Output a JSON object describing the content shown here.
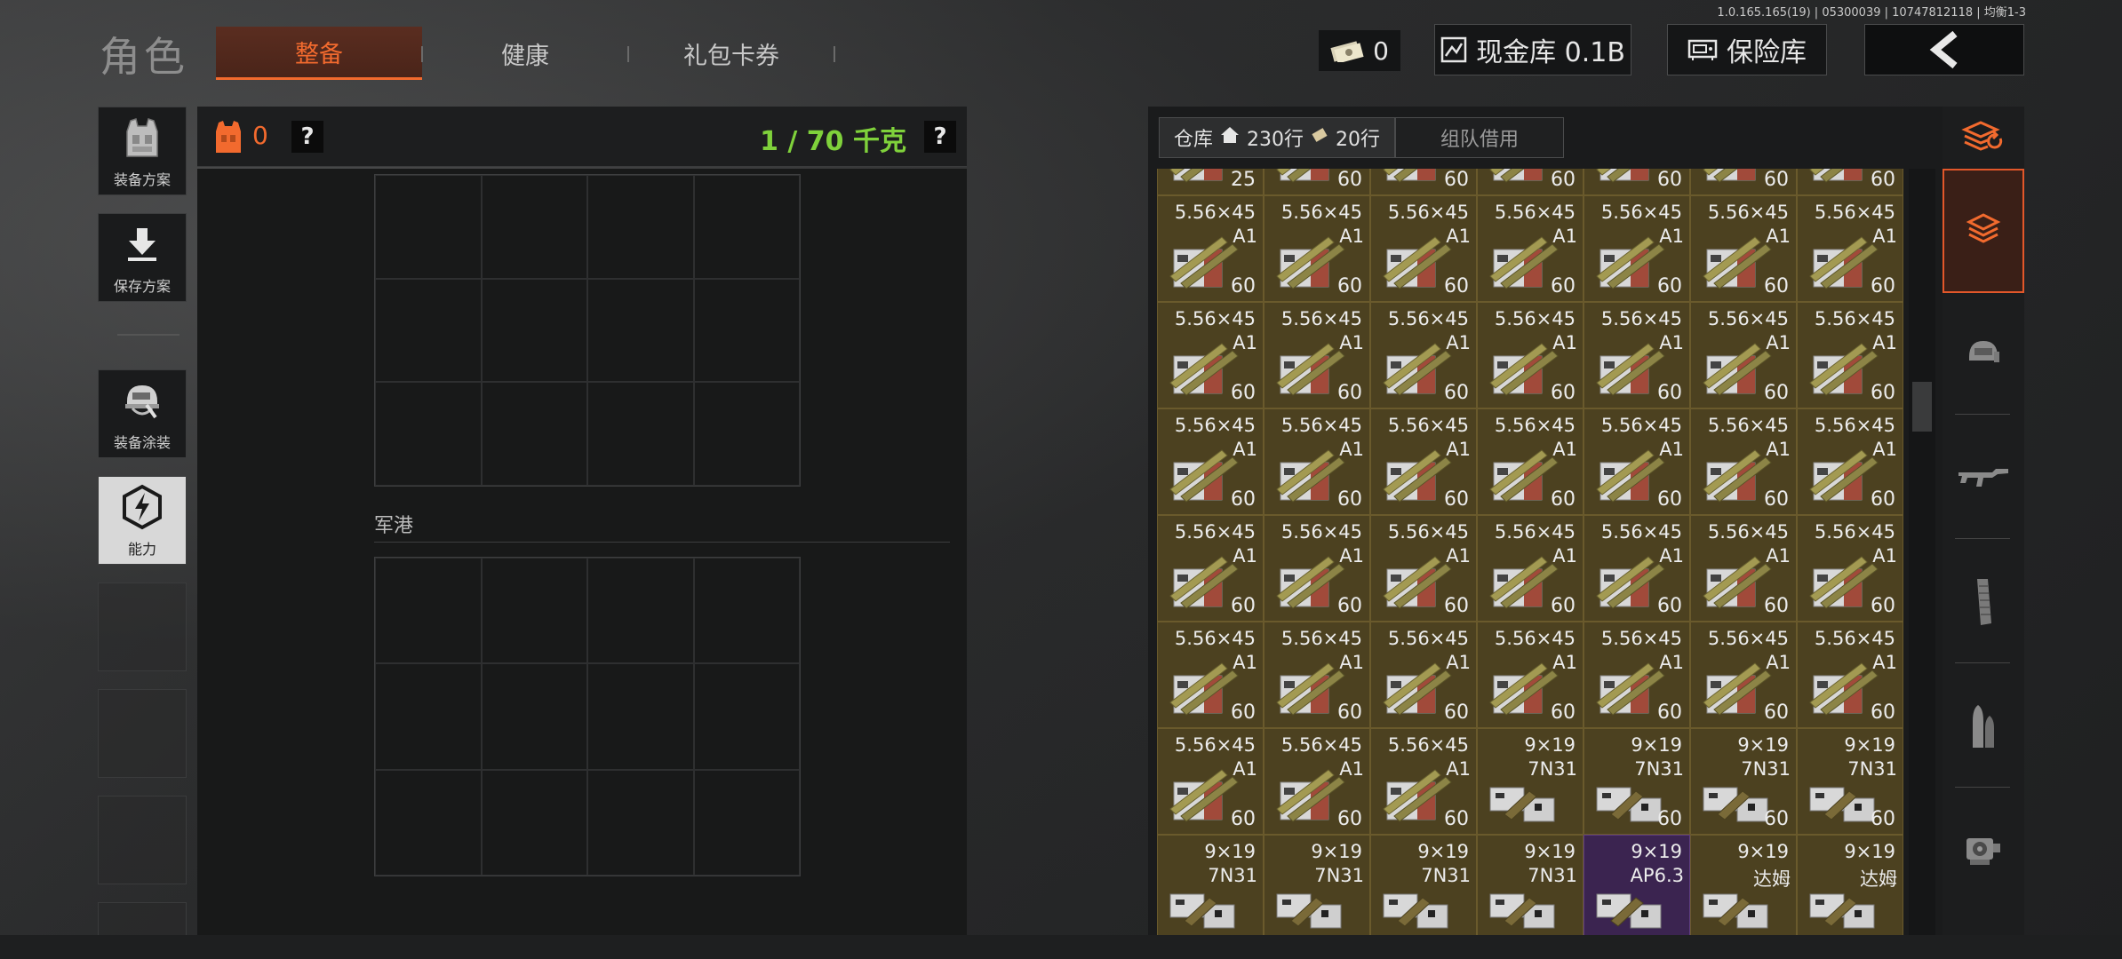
{
  "version": "1.0.165.165(19) | 05300039 | 10747812118 | 均衡1-3",
  "header": {
    "title": "角色",
    "tabs": [
      {
        "label": "整备",
        "active": true
      },
      {
        "label": "健康",
        "active": false
      },
      {
        "label": "礼包卡券",
        "active": false
      }
    ],
    "cash": "0",
    "vault_label": "现金库 0.1B",
    "safe_label": "保险库",
    "back_icon": "chevron-left-icon"
  },
  "sidebar": {
    "items": [
      {
        "label": "装备方案",
        "icon": "vest-icon"
      },
      {
        "label": "保存方案",
        "icon": "download-icon"
      },
      {
        "label": "装备涂装",
        "icon": "helmet-icon"
      },
      {
        "label": "能力",
        "icon": "hex-lightning-icon"
      }
    ]
  },
  "backpack": {
    "armor_count": "0",
    "weight": "1 / 70 千克",
    "help": "?",
    "section_label": "军港"
  },
  "storage": {
    "tab_label": "仓库",
    "rows_home": "230行",
    "rows_ticket": "20行",
    "team_tab": "组队借用",
    "grid": {
      "top_partial_counts": [
        "25",
        "60",
        "60",
        "60",
        "60",
        "60",
        "60"
      ],
      "rows": [
        [
          {
            "t1": "5.56×45",
            "t2": "A1",
            "count": "60",
            "type": "rifle"
          },
          {
            "t1": "5.56×45",
            "t2": "A1",
            "count": "60",
            "type": "rifle"
          },
          {
            "t1": "5.56×45",
            "t2": "A1",
            "count": "60",
            "type": "rifle"
          },
          {
            "t1": "5.56×45",
            "t2": "A1",
            "count": "60",
            "type": "rifle"
          },
          {
            "t1": "5.56×45",
            "t2": "A1",
            "count": "60",
            "type": "rifle"
          },
          {
            "t1": "5.56×45",
            "t2": "A1",
            "count": "60",
            "type": "rifle"
          },
          {
            "t1": "5.56×45",
            "t2": "A1",
            "count": "60",
            "type": "rifle"
          }
        ],
        [
          {
            "t1": "5.56×45",
            "t2": "A1",
            "count": "60",
            "type": "rifle"
          },
          {
            "t1": "5.56×45",
            "t2": "A1",
            "count": "60",
            "type": "rifle"
          },
          {
            "t1": "5.56×45",
            "t2": "A1",
            "count": "60",
            "type": "rifle"
          },
          {
            "t1": "5.56×45",
            "t2": "A1",
            "count": "60",
            "type": "rifle"
          },
          {
            "t1": "5.56×45",
            "t2": "A1",
            "count": "60",
            "type": "rifle"
          },
          {
            "t1": "5.56×45",
            "t2": "A1",
            "count": "60",
            "type": "rifle"
          },
          {
            "t1": "5.56×45",
            "t2": "A1",
            "count": "60",
            "type": "rifle"
          }
        ],
        [
          {
            "t1": "5.56×45",
            "t2": "A1",
            "count": "60",
            "type": "rifle"
          },
          {
            "t1": "5.56×45",
            "t2": "A1",
            "count": "60",
            "type": "rifle"
          },
          {
            "t1": "5.56×45",
            "t2": "A1",
            "count": "60",
            "type": "rifle"
          },
          {
            "t1": "5.56×45",
            "t2": "A1",
            "count": "60",
            "type": "rifle"
          },
          {
            "t1": "5.56×45",
            "t2": "A1",
            "count": "60",
            "type": "rifle"
          },
          {
            "t1": "5.56×45",
            "t2": "A1",
            "count": "60",
            "type": "rifle"
          },
          {
            "t1": "5.56×45",
            "t2": "A1",
            "count": "60",
            "type": "rifle"
          }
        ],
        [
          {
            "t1": "5.56×45",
            "t2": "A1",
            "count": "60",
            "type": "rifle"
          },
          {
            "t1": "5.56×45",
            "t2": "A1",
            "count": "60",
            "type": "rifle"
          },
          {
            "t1": "5.56×45",
            "t2": "A1",
            "count": "60",
            "type": "rifle"
          },
          {
            "t1": "5.56×45",
            "t2": "A1",
            "count": "60",
            "type": "rifle"
          },
          {
            "t1": "5.56×45",
            "t2": "A1",
            "count": "60",
            "type": "rifle"
          },
          {
            "t1": "5.56×45",
            "t2": "A1",
            "count": "60",
            "type": "rifle"
          },
          {
            "t1": "5.56×45",
            "t2": "A1",
            "count": "60",
            "type": "rifle"
          }
        ],
        [
          {
            "t1": "5.56×45",
            "t2": "A1",
            "count": "60",
            "type": "rifle"
          },
          {
            "t1": "5.56×45",
            "t2": "A1",
            "count": "60",
            "type": "rifle"
          },
          {
            "t1": "5.56×45",
            "t2": "A1",
            "count": "60",
            "type": "rifle"
          },
          {
            "t1": "5.56×45",
            "t2": "A1",
            "count": "60",
            "type": "rifle"
          },
          {
            "t1": "5.56×45",
            "t2": "A1",
            "count": "60",
            "type": "rifle"
          },
          {
            "t1": "5.56×45",
            "t2": "A1",
            "count": "60",
            "type": "rifle"
          },
          {
            "t1": "5.56×45",
            "t2": "A1",
            "count": "60",
            "type": "rifle"
          }
        ],
        [
          {
            "t1": "5.56×45",
            "t2": "A1",
            "count": "60",
            "type": "rifle"
          },
          {
            "t1": "5.56×45",
            "t2": "A1",
            "count": "60",
            "type": "rifle"
          },
          {
            "t1": "5.56×45",
            "t2": "A1",
            "count": "60",
            "type": "rifle"
          },
          {
            "t1": "9×19",
            "t2": "7N31",
            "count": "",
            "type": "pistol"
          },
          {
            "t1": "9×19",
            "t2": "7N31",
            "count": "60",
            "type": "pistol"
          },
          {
            "t1": "9×19",
            "t2": "7N31",
            "count": "60",
            "type": "pistol"
          },
          {
            "t1": "9×19",
            "t2": "7N31",
            "count": "60",
            "type": "pistol"
          }
        ],
        [
          {
            "t1": "9×19",
            "t2": "7N31",
            "count": "",
            "type": "pistol"
          },
          {
            "t1": "9×19",
            "t2": "7N31",
            "count": "",
            "type": "pistol"
          },
          {
            "t1": "9×19",
            "t2": "7N31",
            "count": "",
            "type": "pistol"
          },
          {
            "t1": "9×19",
            "t2": "7N31",
            "count": "",
            "type": "pistol"
          },
          {
            "t1": "9×19",
            "t2": "AP6.3",
            "count": "",
            "type": "pistol",
            "rarity": "purple"
          },
          {
            "t1": "9×19",
            "t2": "达姆",
            "count": "",
            "type": "pistol"
          },
          {
            "t1": "9×19",
            "t2": "达姆",
            "count": "",
            "type": "pistol"
          }
        ]
      ]
    }
  },
  "categories": [
    {
      "icon": "stack-refresh-icon",
      "active": false
    },
    {
      "icon": "stack-icon",
      "active": true
    },
    {
      "icon": "helmet-icon",
      "active": false
    },
    {
      "icon": "rifle-icon",
      "active": false
    },
    {
      "icon": "magazine-icon",
      "active": false
    },
    {
      "icon": "ammo-icon",
      "active": false
    },
    {
      "icon": "scope-icon",
      "active": false
    }
  ],
  "colors": {
    "accent": "#f26a2e",
    "weight_green": "#7fd13b",
    "item_gold": "#4c4120",
    "item_purple": "#3b2450"
  }
}
